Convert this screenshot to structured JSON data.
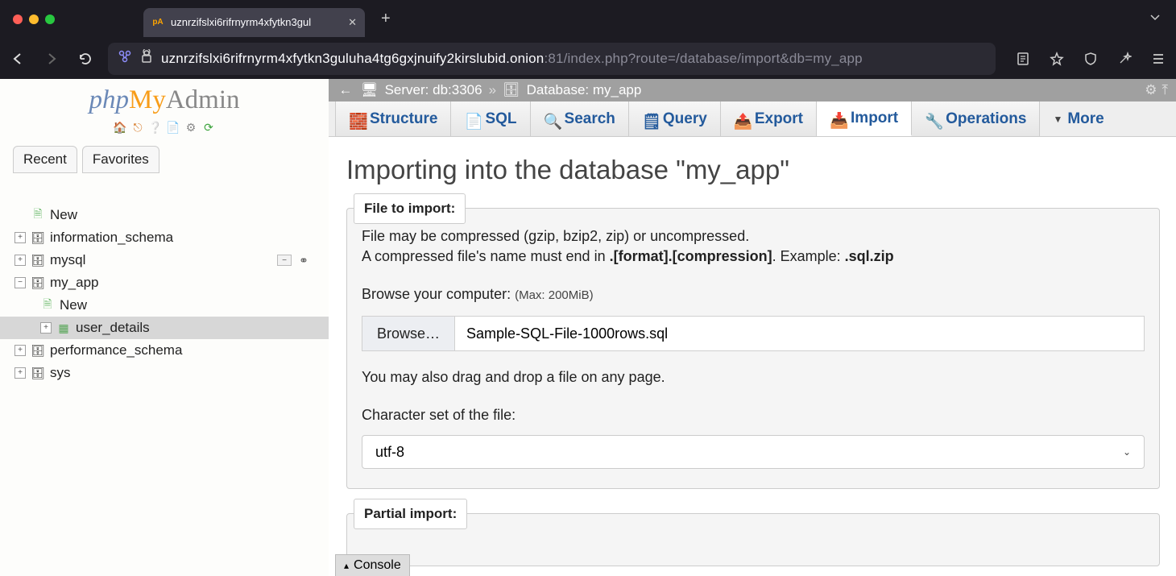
{
  "browser": {
    "tab_title": "uznrzifslxi6rifrnyrm4xfytkn3gul",
    "url_host": "uznrzifslxi6rifrnyrm4xfytkn3guluha4tg6gxjnuify2kirslubid.onion",
    "url_port_path": ":81/index.php?route=/database/import&db=my_app"
  },
  "logo": {
    "php": "php",
    "my": "My",
    "admin": "Admin"
  },
  "sidebar": {
    "tabs": {
      "recent": "Recent",
      "favorites": "Favorites"
    },
    "new": "New",
    "databases": [
      "information_schema",
      "mysql",
      "my_app",
      "performance_schema",
      "sys"
    ],
    "myapp_children": {
      "new": "New",
      "table": "user_details"
    }
  },
  "breadcrumb": {
    "server_label": "Server: db:3306",
    "db_label": "Database: my_app"
  },
  "tabs": {
    "structure": "Structure",
    "sql": "SQL",
    "search": "Search",
    "query": "Query",
    "export": "Export",
    "import": "Import",
    "operations": "Operations",
    "more": "More"
  },
  "page": {
    "title": "Importing into the database \"my_app\"",
    "legend1": "File to import:",
    "compress_line1": "File may be compressed (gzip, bzip2, zip) or uncompressed.",
    "compress_line2a": "A compressed file's name must end in ",
    "compress_line2b": ".[format].[compression]",
    "compress_line2c": ". Example: ",
    "compress_line2d": ".sql.zip",
    "browse_label": "Browse your computer: ",
    "browse_hint": "(Max: 200MiB)",
    "browse_button": "Browse…",
    "file_name": "Sample-SQL-File-1000rows.sql",
    "dragdrop": "You may also drag and drop a file on any page.",
    "charset_label": "Character set of the file:",
    "charset_value": "utf-8",
    "legend2": "Partial import:",
    "console": "Console"
  }
}
